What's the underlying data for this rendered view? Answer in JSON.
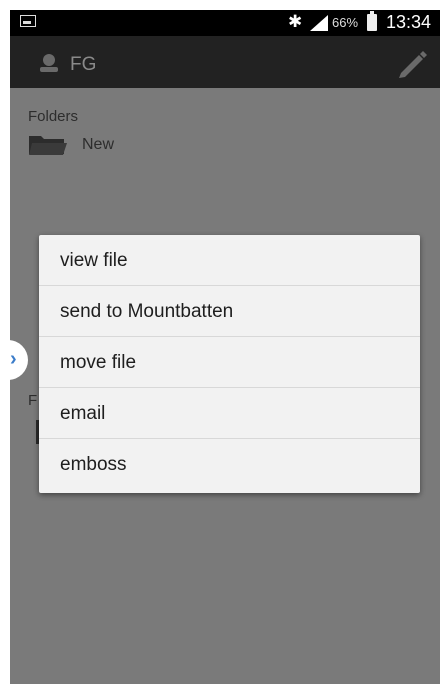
{
  "status_bar": {
    "battery_percent": "66%",
    "time": "13:34"
  },
  "app_bar": {
    "title": "FG"
  },
  "content": {
    "folders_label": "Folders",
    "folders": [
      {
        "name": "New"
      }
    ],
    "files_label_partial": "F"
  },
  "context_menu": {
    "items": [
      {
        "label": "view file"
      },
      {
        "label": "send to Mountbatten"
      },
      {
        "label": "move file"
      },
      {
        "label": "email"
      },
      {
        "label": "emboss"
      }
    ]
  },
  "icons": {
    "drawer_handle": "chevron-right-icon"
  },
  "colors": {
    "dim_background": "#7a7a7a",
    "app_bar": "#222222",
    "menu_background": "#f2f2f2",
    "accent": "#3b7cc9"
  }
}
